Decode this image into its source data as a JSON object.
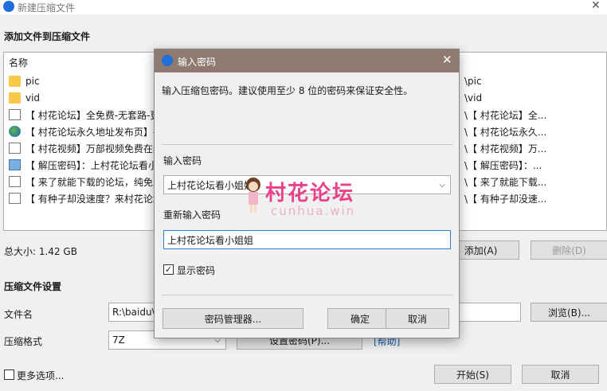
{
  "window": {
    "title": "新建压缩文件"
  },
  "add_section": {
    "label": "添加文件到压缩文件"
  },
  "file_list": {
    "column_name": "名称",
    "items": [
      {
        "name": "pic",
        "icon": "folder-icon",
        "path": "\\pic"
      },
      {
        "name": "vid",
        "icon": "folder-icon",
        "path": "\\vid"
      },
      {
        "name": "【 村花论坛】全免费-无套路-更",
        "icon": "document-icon",
        "path": "\\【 村花论坛】全..."
      },
      {
        "name": "【 村花论坛永久地址发布页】-",
        "icon": "globe-icon",
        "path": "\\【 村花论坛永久..."
      },
      {
        "name": "【 村花视频】万部视频免费在线",
        "icon": "document-icon",
        "path": "\\【 村花视频】万..."
      },
      {
        "name": "【 解压密码】：上村花论坛看小",
        "icon": "image-icon",
        "path": "\\【 解压密码】：..."
      },
      {
        "name": "【 来了就能下载的论坛，纯免费",
        "icon": "document-icon",
        "path": "\\【 来了就能下载..."
      },
      {
        "name": "【 有种子却没速度？来村花论坛",
        "icon": "document-icon",
        "path": "\\【 有种子却没速..."
      }
    ]
  },
  "summary": {
    "total_size": "总大小: 1.42 GB",
    "add_label": "添加(A)",
    "delete_label": "删除(D)"
  },
  "settings": {
    "label": "压缩文件设置",
    "filename_label": "文件名",
    "filename_value": "R:\\baidu\\",
    "browse_label": "浏览(B)...",
    "format_label": "压缩格式",
    "format_value": "7Z",
    "set_password_label": "设置密码(P)...",
    "help_label": "[帮助]"
  },
  "footer": {
    "more_options": "更多选项...",
    "start_label": "开始(S)",
    "cancel_label": "取消"
  },
  "dialog": {
    "title": "输入密码",
    "hint": "输入压缩包密码。建议使用至少 8 位的密码来保证安全性。",
    "password_label": "输入密码",
    "password_value": "上村花论坛看小姐姐",
    "reenter_label": "重新输入密码",
    "reenter_value": "上村花论坛看小姐姐",
    "show_password_label": "显示密码",
    "show_password_checked": true,
    "manager_label": "密码管理器...",
    "ok_label": "确定",
    "cancel_label": "取消"
  },
  "watermark": {
    "logo_text": "村花论坛",
    "domain": "cunhua.win"
  },
  "colors": {
    "dialog_title_bg": "#8e7a71",
    "app_icon": "#1e6fd9",
    "watermark": "#e8428a",
    "help_link": "#1a5fb4"
  }
}
